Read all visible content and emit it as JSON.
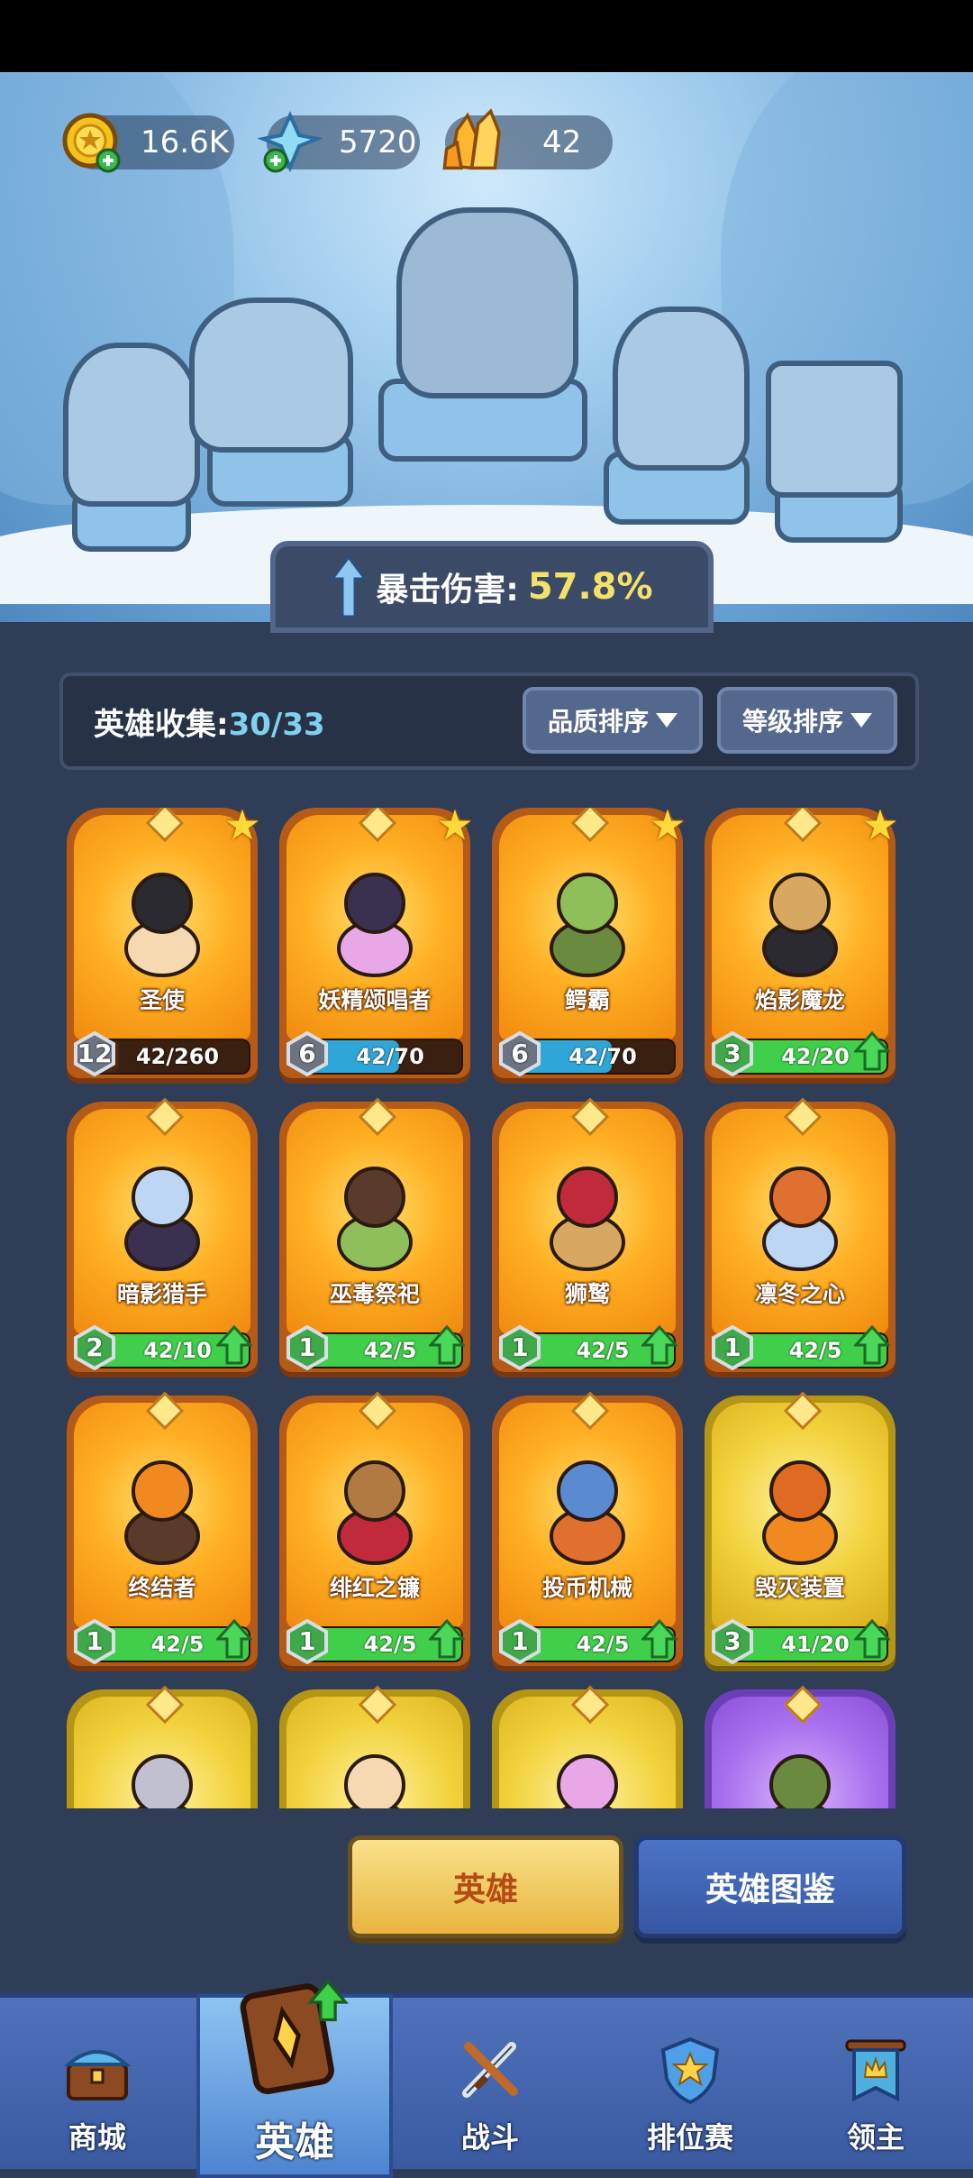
{
  "resources": {
    "gold": {
      "value": "16.6K",
      "icon": "gold-coin-plus-icon"
    },
    "diamond": {
      "value": "5720",
      "icon": "blue-crystal-plus-icon"
    },
    "crystal": {
      "value": "42",
      "icon": "orange-crystal-icon"
    }
  },
  "crit": {
    "label": "暴击伤害:",
    "value": "57.8%"
  },
  "collection": {
    "label": "英雄收集:",
    "count": "30/33"
  },
  "sort": {
    "quality": "品质排序",
    "level": "等级排序"
  },
  "heroes": [
    {
      "name": "圣使",
      "level": "12",
      "progress": "42/260",
      "fill": 0.16,
      "starred": true,
      "can_upgrade": false,
      "rarity": "orange",
      "bar": "brown"
    },
    {
      "name": "妖精颂唱者",
      "level": "6",
      "progress": "42/70",
      "fill": 0.6,
      "starred": true,
      "can_upgrade": false,
      "rarity": "orange",
      "bar": "blue"
    },
    {
      "name": "鳄霸",
      "level": "6",
      "progress": "42/70",
      "fill": 0.6,
      "starred": true,
      "can_upgrade": false,
      "rarity": "orange",
      "bar": "blue"
    },
    {
      "name": "焰影魔龙",
      "level": "3",
      "progress": "42/20",
      "fill": 1,
      "starred": true,
      "can_upgrade": true,
      "rarity": "orange",
      "bar": "green"
    },
    {
      "name": "暗影猎手",
      "level": "2",
      "progress": "42/10",
      "fill": 1,
      "starred": false,
      "can_upgrade": true,
      "rarity": "orange",
      "bar": "green"
    },
    {
      "name": "巫毒祭祀",
      "level": "1",
      "progress": "42/5",
      "fill": 1,
      "starred": false,
      "can_upgrade": true,
      "rarity": "orange",
      "bar": "green"
    },
    {
      "name": "狮鹫",
      "level": "1",
      "progress": "42/5",
      "fill": 1,
      "starred": false,
      "can_upgrade": true,
      "rarity": "orange",
      "bar": "green"
    },
    {
      "name": "凛冬之心",
      "level": "1",
      "progress": "42/5",
      "fill": 1,
      "starred": false,
      "can_upgrade": true,
      "rarity": "orange",
      "bar": "green"
    },
    {
      "name": "终结者",
      "level": "1",
      "progress": "42/5",
      "fill": 1,
      "starred": false,
      "can_upgrade": true,
      "rarity": "orange",
      "bar": "green"
    },
    {
      "name": "绯红之镰",
      "level": "1",
      "progress": "42/5",
      "fill": 1,
      "starred": false,
      "can_upgrade": true,
      "rarity": "orange",
      "bar": "green"
    },
    {
      "name": "投币机械",
      "level": "1",
      "progress": "42/5",
      "fill": 1,
      "starred": false,
      "can_upgrade": true,
      "rarity": "orange",
      "bar": "green"
    },
    {
      "name": "毁灭装置",
      "level": "3",
      "progress": "41/20",
      "fill": 1,
      "starred": false,
      "can_upgrade": true,
      "rarity": "gold",
      "bar": "green"
    },
    {
      "name": "",
      "level": "",
      "progress": "",
      "fill": 0,
      "starred": false,
      "can_upgrade": false,
      "rarity": "gold",
      "bar": "none"
    },
    {
      "name": "",
      "level": "",
      "progress": "",
      "fill": 0,
      "starred": false,
      "can_upgrade": false,
      "rarity": "gold",
      "bar": "none"
    },
    {
      "name": "",
      "level": "",
      "progress": "",
      "fill": 0,
      "starred": false,
      "can_upgrade": false,
      "rarity": "gold",
      "bar": "none"
    },
    {
      "name": "",
      "level": "",
      "progress": "",
      "fill": 0,
      "starred": false,
      "can_upgrade": false,
      "rarity": "purple",
      "bar": "none"
    }
  ],
  "tabs": {
    "hero": "英雄",
    "codex": "英雄图鉴"
  },
  "nav": [
    {
      "label": "商城",
      "icon": "chest-shop-icon",
      "active": false
    },
    {
      "label": "英雄",
      "icon": "hero-card-icon",
      "active": true
    },
    {
      "label": "战斗",
      "icon": "crossed-swords-icon",
      "active": false
    },
    {
      "label": "排位赛",
      "icon": "rank-shield-icon",
      "active": false
    },
    {
      "label": "领主",
      "icon": "lord-banner-icon",
      "active": false
    }
  ],
  "colors": {
    "bar_green": "#3fcf4a",
    "bar_blue": "#2fa6d8",
    "bar_brown": "#4a2812",
    "accent_yellow": "#f4e16a",
    "cyan_count": "#7fd1ee"
  }
}
